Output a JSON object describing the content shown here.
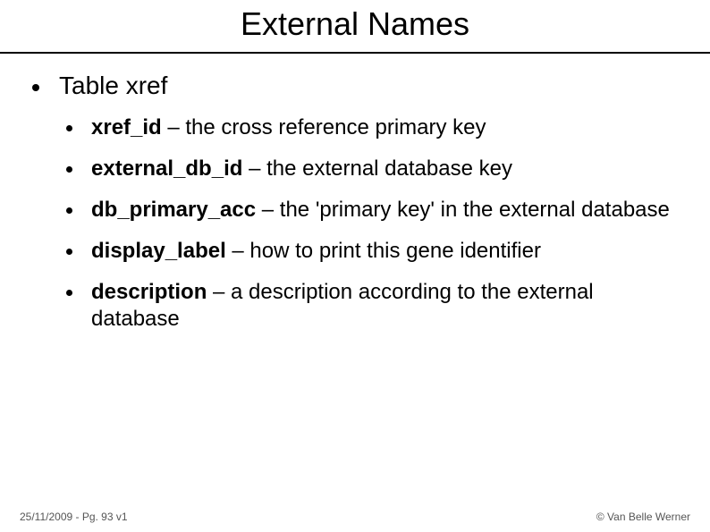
{
  "title": "External Names",
  "main": {
    "heading": "Table xref",
    "items": [
      {
        "term": "xref_id",
        "desc": " – the cross reference primary key"
      },
      {
        "term": "external_db_id",
        "desc": " – the external database key"
      },
      {
        "term": "db_primary_acc",
        "desc": " – the 'primary key' in the external database"
      },
      {
        "term": "display_label",
        "desc": " – how to print this gene identifier"
      },
      {
        "term": "description",
        "desc": " – a description according to the external database"
      }
    ]
  },
  "footer": {
    "left": "25/11/2009 - Pg. 93 v1",
    "right": "© Van Belle Werner"
  }
}
